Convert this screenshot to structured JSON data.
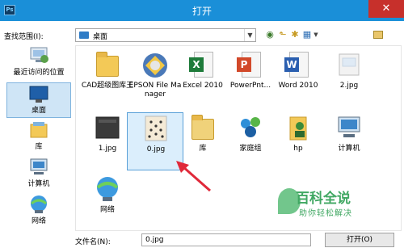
{
  "window": {
    "title": "打开",
    "app_badge": "Ps",
    "close_glyph": "✕"
  },
  "address_bar": {
    "label": "查找范围(I):",
    "location": "桌面"
  },
  "places": [
    {
      "label": "最近访问的位置",
      "icon": "recent-places-icon"
    },
    {
      "label": "桌面",
      "icon": "desktop-icon",
      "selected": true
    },
    {
      "label": "库",
      "icon": "libraries-icon"
    },
    {
      "label": "计算机",
      "icon": "computer-icon"
    },
    {
      "label": "网络",
      "icon": "network-icon"
    }
  ],
  "files": [
    {
      "name": "CAD超级图库王",
      "type": "folder"
    },
    {
      "name": "EPSON File Manager",
      "type": "app"
    },
    {
      "name": "Excel 2010",
      "type": "excel"
    },
    {
      "name": "PowerPnt...",
      "type": "powerpoint"
    },
    {
      "name": "Word 2010",
      "type": "word"
    },
    {
      "name": "2.jpg",
      "type": "image"
    },
    {
      "name": "1.jpg",
      "type": "image-dark"
    },
    {
      "name": "0.jpg",
      "type": "image-dots",
      "selected": true
    },
    {
      "name": "库",
      "type": "library-folder"
    },
    {
      "name": "家庭组",
      "type": "homegroup"
    },
    {
      "name": "hp",
      "type": "user-folder"
    },
    {
      "name": "计算机",
      "type": "computer"
    },
    {
      "name": "网络",
      "type": "network"
    }
  ],
  "filename": {
    "label": "文件名(N):",
    "value": "0.jpg"
  },
  "buttons": {
    "open": "打开(O)"
  },
  "watermark": {
    "title": "百科全说",
    "subtitle": "助你轻松解决"
  },
  "colors": {
    "titlebar": "#1a8fd8",
    "close": "#c7302b",
    "selection": "#dbeefc",
    "arrow": "#e0293a"
  }
}
